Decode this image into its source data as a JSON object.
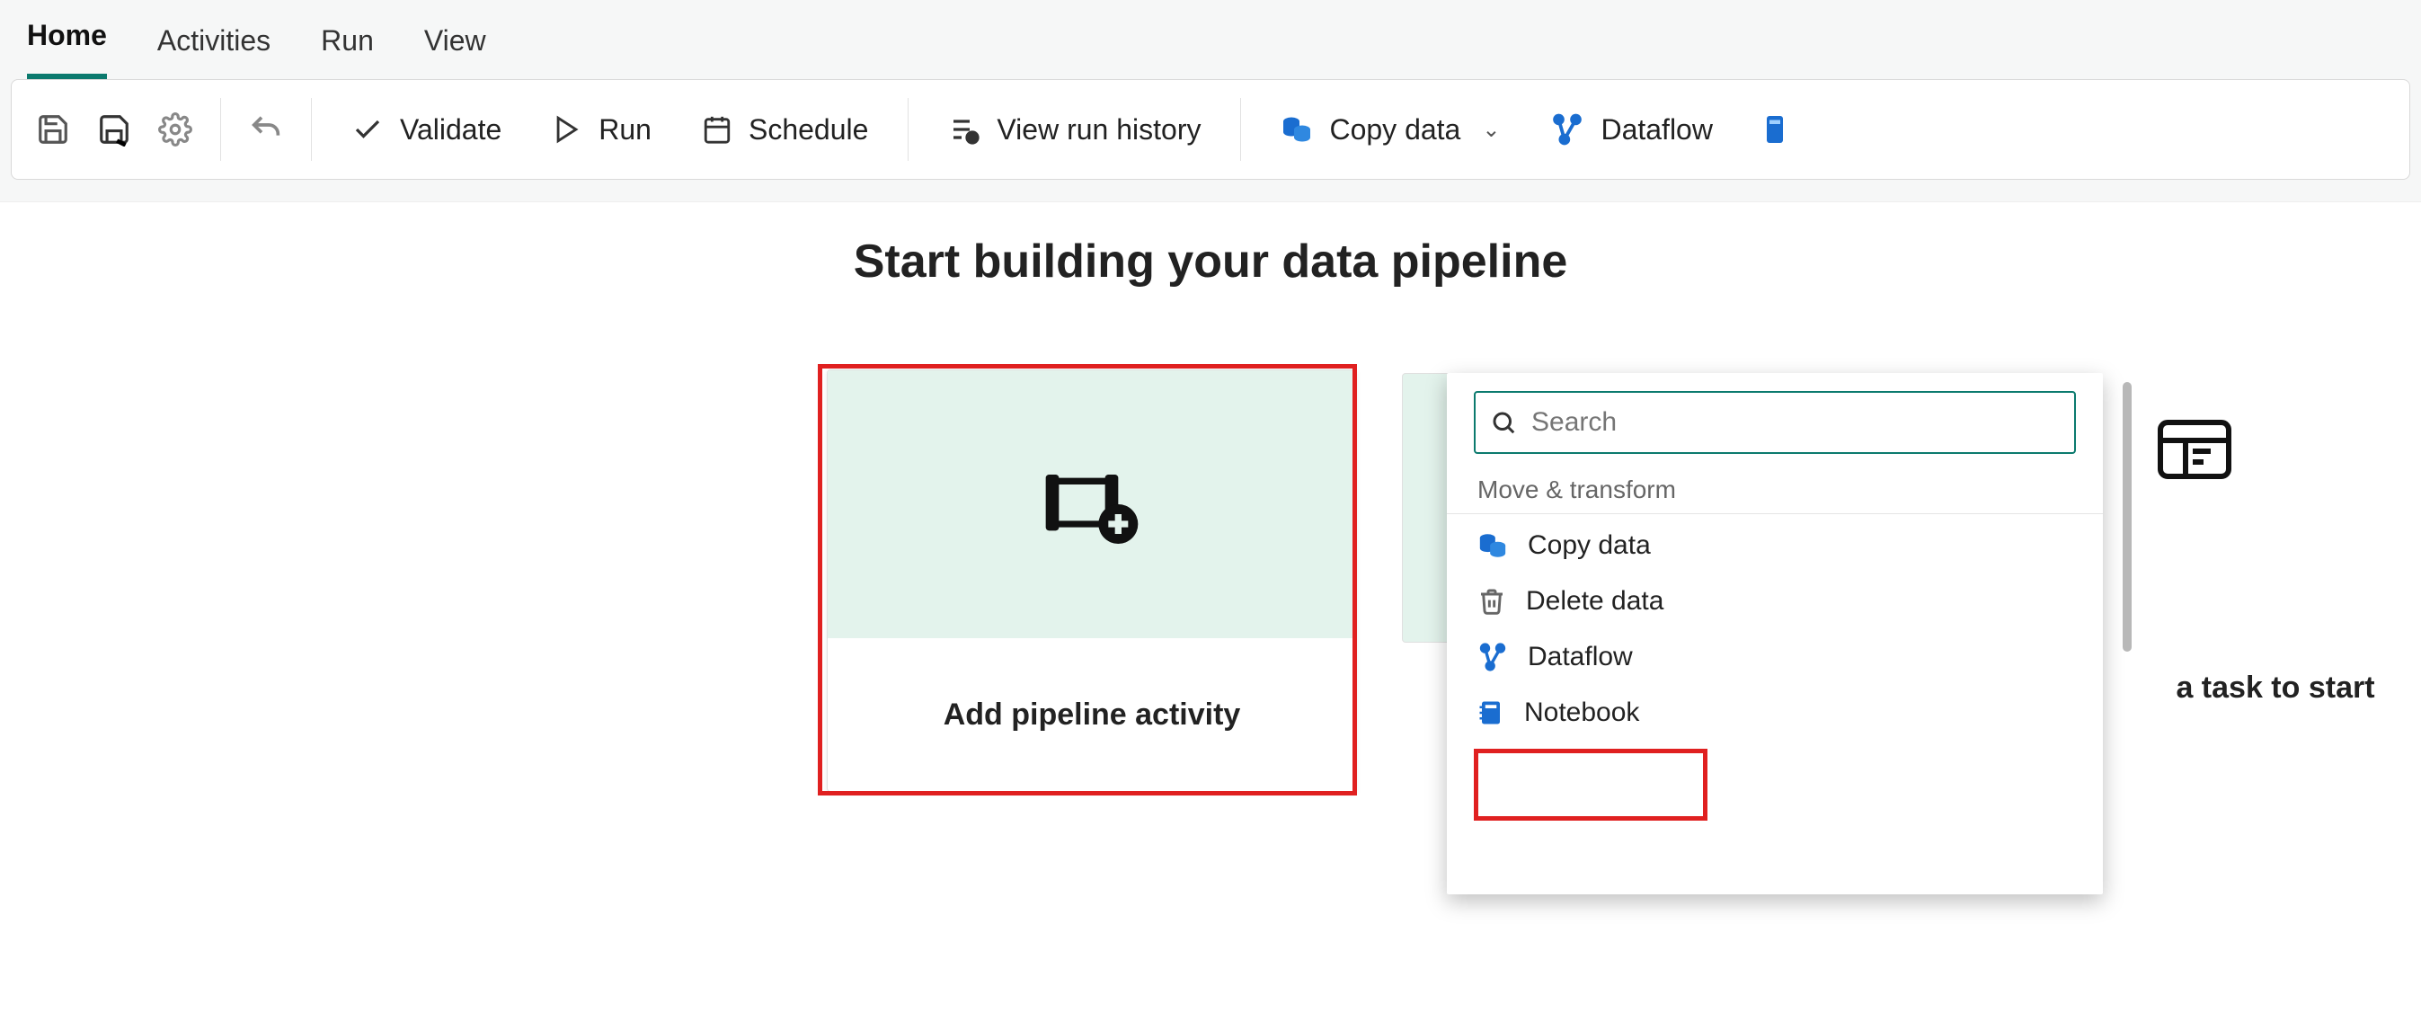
{
  "tabs": {
    "home": "Home",
    "activities": "Activities",
    "run": "Run",
    "view": "View"
  },
  "toolbar": {
    "validate": "Validate",
    "run": "Run",
    "schedule": "Schedule",
    "view_run_history": "View run history",
    "copy_data": "Copy data",
    "dataflow": "Dataflow"
  },
  "headline": "Start building your data pipeline",
  "cards": {
    "add_activity": "Add pipeline activity",
    "task_start": "a task to start"
  },
  "search": {
    "placeholder": "Search"
  },
  "activity_groups": {
    "move_transform": {
      "title": "Move & transform",
      "copy_data": "Copy data",
      "delete_data": "Delete data",
      "dataflow": "Dataflow",
      "notebook": "Notebook"
    }
  },
  "colors": {
    "accent": "#0b7a6e",
    "azure": "#1a6dd0",
    "highlight": "#e02020"
  }
}
